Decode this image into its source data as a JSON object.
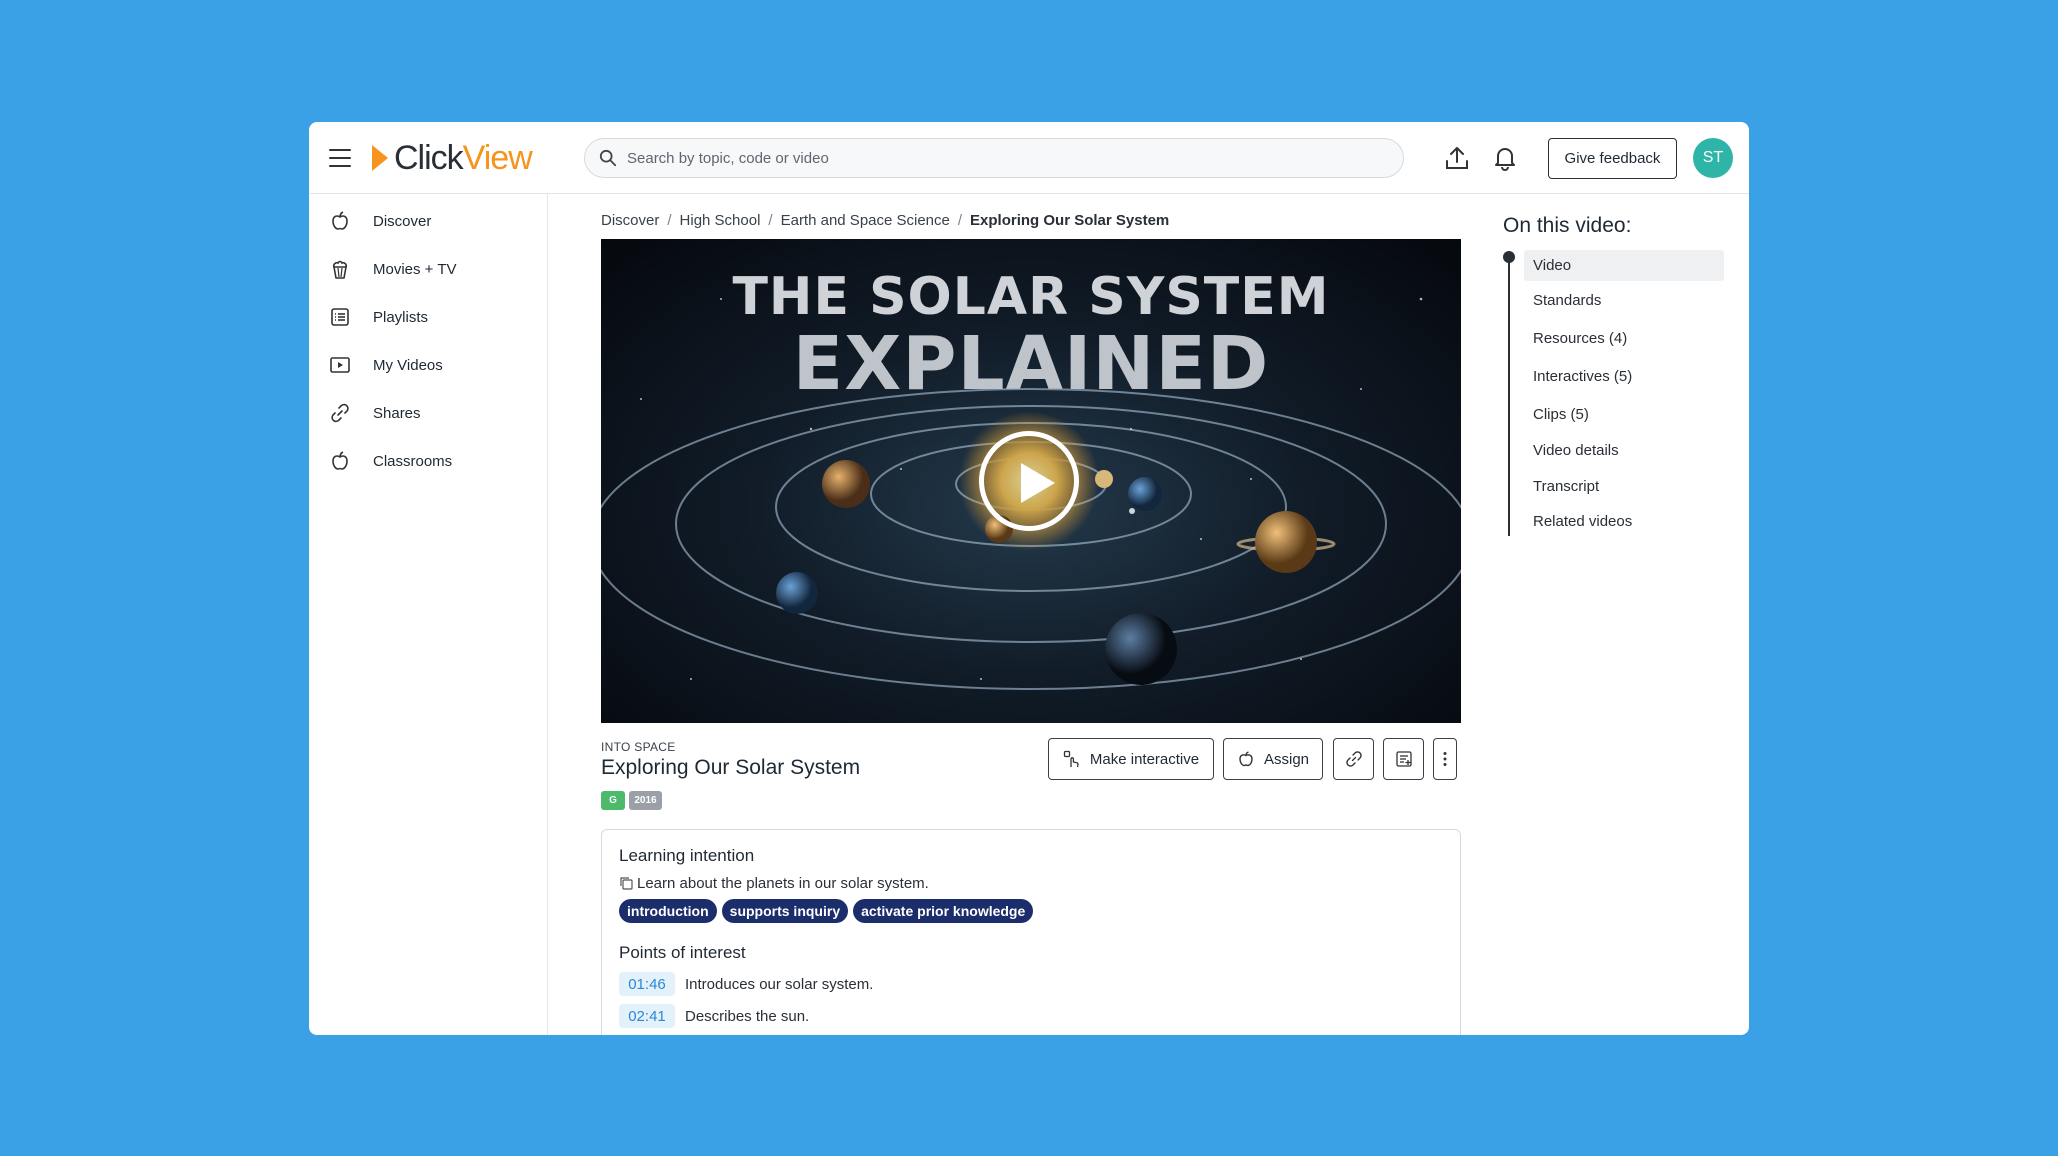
{
  "header": {
    "logo_part1": "Click",
    "logo_part2": "View",
    "search_placeholder": "Search by topic, code or video",
    "feedback_label": "Give feedback",
    "avatar_initials": "ST"
  },
  "sidebar": {
    "items": [
      {
        "label": "Discover",
        "icon": "apple-icon"
      },
      {
        "label": "Movies + TV",
        "icon": "popcorn-icon"
      },
      {
        "label": "Playlists",
        "icon": "list-icon"
      },
      {
        "label": "My Videos",
        "icon": "video-play-icon"
      },
      {
        "label": "Shares",
        "icon": "link-icon"
      },
      {
        "label": "Classrooms",
        "icon": "apple-icon"
      }
    ]
  },
  "breadcrumb": [
    "Discover",
    "High School",
    "Earth and Space Science",
    "Exploring Our Solar System"
  ],
  "video": {
    "title_line1": "THE SOLAR SYSTEM",
    "title_line2": "EXPLAINED",
    "series": "INTO SPACE",
    "title": "Exploring Our Solar System",
    "rating_badge": "G",
    "year_badge": "2016"
  },
  "actions": {
    "make_interactive": "Make interactive",
    "assign": "Assign"
  },
  "learning": {
    "heading": "Learning intention",
    "text": "Learn about the planets in our solar system.",
    "tags": [
      "introduction",
      "supports inquiry",
      "activate prior knowledge"
    ],
    "poi_heading": "Points of interest",
    "points": [
      {
        "time": "01:46",
        "text": "Introduces our solar system."
      },
      {
        "time": "02:41",
        "text": "Describes the sun."
      }
    ]
  },
  "toc": {
    "title": "On this video:",
    "items": [
      "Video",
      "Standards",
      "Resources (4)",
      "Interactives (5)",
      "Clips (5)",
      "Video details",
      "Transcript",
      "Related videos"
    ]
  },
  "colors": {
    "background": "#3ba1e6",
    "brand_orange": "#f7941d",
    "avatar": "#2fb5a8",
    "tag": "#1c2d6b",
    "rating_badge": "#4cba6a",
    "year_badge": "#9aa0a6"
  }
}
